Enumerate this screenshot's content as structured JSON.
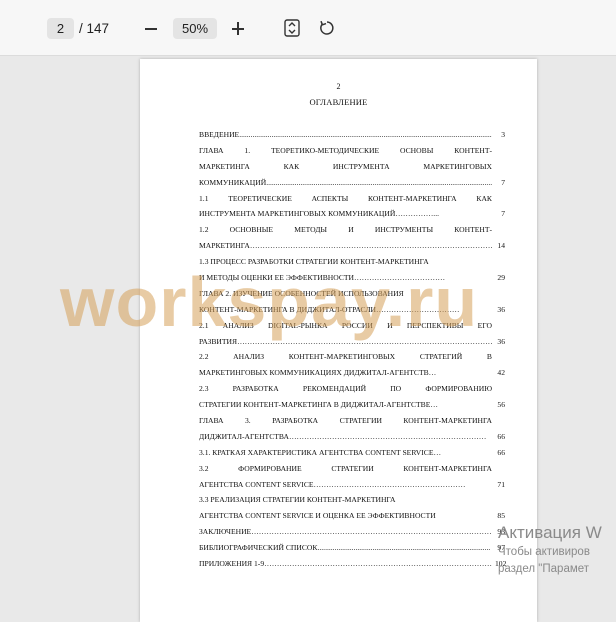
{
  "toolbar": {
    "current_page": "2",
    "total_pages": "/ 147",
    "zoom": "50%",
    "zoom_out_icon": "minus-icon",
    "zoom_in_icon": "plus-icon",
    "fit_icon": "fit-page-icon",
    "rotate_icon": "rotate-icon"
  },
  "document": {
    "page_number": "2",
    "heading": "ОГЛАВЛЕНИЕ",
    "toc": [
      {
        "text": "ВВЕДЕНИЕ.....................................................................................................................................................",
        "page": "3",
        "justify": false
      },
      {
        "text": "ГЛАВА 1. ТЕОРЕТИКО-МЕТОДИЧЕСКИЕ ОСНОВЫ КОНТЕНТ-",
        "page": "",
        "justify": true
      },
      {
        "text": "МАРКЕТИНГА КАК ИНСТРУМЕНТА МАРКЕТИНГОВЫХ",
        "page": "",
        "justify": true
      },
      {
        "text": "КОММУНИКАЦИЙ..................................................................................................................................",
        "page": "7",
        "justify": false
      },
      {
        "text": "1.1 ТЕОРЕТИЧЕСКИЕ АСПЕКТЫ КОНТЕНТ-МАРКЕТИНГА КАК",
        "page": "",
        "justify": true
      },
      {
        "text": "ИНСТРУМЕНТА МАРКЕТИНГОВЫХ КОММУНИКАЦИЙ……………...",
        "page": "7",
        "justify": false
      },
      {
        "text": "1.2 ОСНОВНЫЕ МЕТОДЫ И ИНСТРУМЕНТЫ КОНТЕНТ-",
        "page": "",
        "justify": true
      },
      {
        "text": "МАРКЕТИНГА……………………………………………………………………………………",
        "page": "14",
        "justify": false
      },
      {
        "text": "1.3 ПРОЦЕСС РАЗРАБОТКИ СТРАТЕГИИ КОНТЕНТ-МАРКЕТИНГА",
        "page": "",
        "justify": false
      },
      {
        "text": "И МЕТОДЫ ОЦЕНКИ ЕЕ ЭФФЕКТИВНОСТИ………………………………",
        "page": "29",
        "justify": false
      },
      {
        "text": "ГЛАВА 2. ИЗУЧЕНИЕ ОСОБЕННОСТЕЙ ИСПОЛЬЗОВАНИЯ",
        "page": "",
        "justify": false
      },
      {
        "text": "КОНТЕНТ-МАРКЕТИНГА В ДИДЖИТАЛ-ОТРАСЛИ……………………………",
        "page": "36",
        "justify": false
      },
      {
        "text": "2.1 АНАЛИЗ DIGITAL-РЫНКА РОССИИ И ПЕРСПЕКТИВЫ ЕГО",
        "page": "",
        "justify": true
      },
      {
        "text": "РАЗВИТИЯ……………………………………………………………………………………………",
        "page": "36",
        "justify": false
      },
      {
        "text": "2.2 АНАЛИЗ КОНТЕНТ-МАРКЕТИНГОВЫХ СТРАТЕГИЙ В",
        "page": "",
        "justify": true
      },
      {
        "text": "МАРКЕТИНГОВЫХ КОММУНИКАЦИЯХ ДИДЖИТАЛ-АГЕНТСТВ…",
        "page": "42",
        "justify": false
      },
      {
        "text": "2.3 РАЗРАБОТКА РЕКОМЕНДАЦИЙ ПО ФОРМИРОВАНИЮ",
        "page": "",
        "justify": true
      },
      {
        "text": "СТРАТЕГИИ КОНТЕНТ-МАРКЕТИНГА В ДИДЖИТАЛ-АГЕНТСТВЕ…",
        "page": "56",
        "justify": false
      },
      {
        "text": "ГЛАВА 3. РАЗРАБОТКА СТРАТЕГИИ КОНТЕНТ-МАРКЕТИНГА",
        "page": "",
        "justify": true
      },
      {
        "text": "ДИДЖИТАЛ-АГЕНТСТВА……………………………………………………………………",
        "page": "66",
        "justify": false
      },
      {
        "text": "3.1. КРАТКАЯ ХАРАКТЕРИСТИКА АГЕНТСТВА CONTENT SERVICE…",
        "page": "66",
        "justify": false
      },
      {
        "text": "3.2 ФОРМИРОВАНИЕ СТРАТЕГИИ КОНТЕНТ-МАРКЕТИНГА",
        "page": "",
        "justify": true
      },
      {
        "text": "АГЕНТСТВА CONTENT SERVICE……………………………………………………",
        "page": "71",
        "justify": false
      },
      {
        "text": "3.3 РЕАЛИЗАЦИЯ СТРАТЕГИИ КОНТЕНТ-МАРКЕТИНГА",
        "page": "",
        "justify": false
      },
      {
        "text": "АГЕНТСТВА CONTENT SERVICE И ОЦЕНКА ЕЕ ЭФФЕКТИВНОСТИ",
        "page": "85",
        "justify": false
      },
      {
        "text": "ЗАКЛЮЧЕНИЕ……………………………………………………………………………………………",
        "page": "93",
        "justify": false
      },
      {
        "text": "БИБЛИОГРАФИЧЕСКИЙ СПИСОК...........................................................................................",
        "page": "97",
        "justify": false
      },
      {
        "text": "ПРИЛОЖЕНИЯ 1-9…………………………………………………………………………………",
        "page": "102",
        "justify": false
      }
    ]
  },
  "watermark": "workspay.ru",
  "activation": {
    "title": "Активация W",
    "line1": "Чтобы активиров",
    "line2": "раздел \"Парамет"
  }
}
